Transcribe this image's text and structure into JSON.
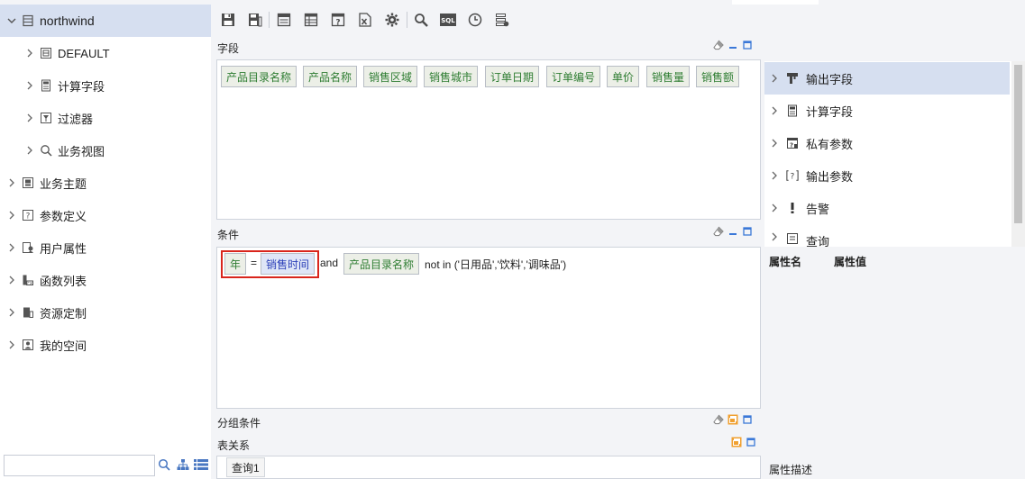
{
  "tree": {
    "root": "northwind",
    "children": [
      "DEFAULT",
      "计算字段",
      "过滤器",
      "业务视图"
    ],
    "siblings": [
      "业务主题",
      "参数定义",
      "用户属性",
      "函数列表",
      "资源定制",
      "我的空间"
    ]
  },
  "search": {
    "value": ""
  },
  "panels": {
    "fields_title": "字段",
    "conditions_title": "条件",
    "group_title": "分组条件",
    "relation_title": "表关系"
  },
  "fields": [
    "产品目录名称",
    "产品名称",
    "销售区域",
    "销售城市",
    "订单日期",
    "订单编号",
    "单价",
    "销售量",
    "销售额"
  ],
  "condition": {
    "chip_year": "年",
    "equals": "=",
    "chip_time": "销售时间",
    "and": "and",
    "chip_catalog": "产品目录名称",
    "tail": "not in ('日用品','饮料','调味品')"
  },
  "bottom_tab": "查询1",
  "right_tree": [
    "输出字段",
    "计算字段",
    "私有参数",
    "输出参数",
    "告警",
    "查询"
  ],
  "properties": {
    "name_header": "属性名",
    "value_header": "属性值",
    "desc_label": "属性描述"
  },
  "colors": {
    "selected_row": "#d6dff0",
    "field_chip_bg": "#ecefe7",
    "field_chip_text": "#2e7d32",
    "highlight_border": "#d9251c",
    "time_chip_bg": "#dfe6f7",
    "time_chip_text": "#2b3fb8"
  }
}
